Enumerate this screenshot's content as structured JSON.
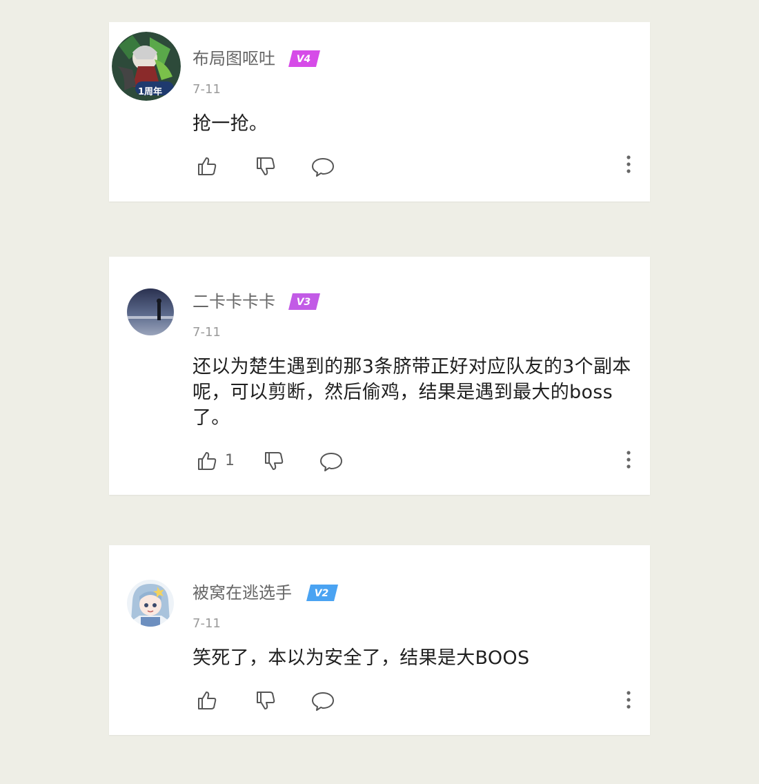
{
  "comments": [
    {
      "username": "布局图呕吐",
      "level": "V4",
      "level_color": "#d64be8",
      "avatar_badge": "1周年",
      "date": "7-11",
      "text": "抢一抢。",
      "like_count": ""
    },
    {
      "username": "二卡卡卡卡",
      "level": "V3",
      "level_color": "#c25be6",
      "date": "7-11",
      "text": "还以为楚生遇到的那3条脐带正好对应队友的3个副本呢，可以剪断，然后偷鸡，结果是遇到最大的boss了。",
      "like_count": "1"
    },
    {
      "username": "被窝在逃选手",
      "level": "V2",
      "level_color": "#4aa3f2",
      "date": "7-11",
      "text": "笑死了，本以为安全了，结果是大BOOS",
      "like_count": ""
    }
  ],
  "icons": [
    "thumbs-up-icon",
    "thumbs-down-icon",
    "comment-bubble-icon",
    "more-vertical-icon"
  ]
}
